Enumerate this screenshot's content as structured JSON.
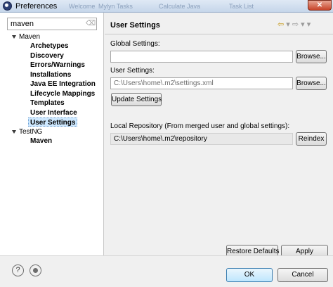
{
  "window": {
    "title": "Preferences",
    "background_tabs": [
      "Welcome",
      "Mylyn Tasks",
      "Calculate Java",
      "Task List"
    ],
    "close_label": "✕"
  },
  "filter": {
    "value": "maven",
    "clear_icon": "clear-icon"
  },
  "tree": {
    "items": [
      {
        "label": "Maven",
        "level": 0,
        "expanded": true
      },
      {
        "label": "Archetypes",
        "level": 1
      },
      {
        "label": "Discovery",
        "level": 1
      },
      {
        "label": "Errors/Warnings",
        "level": 1
      },
      {
        "label": "Installations",
        "level": 1
      },
      {
        "label": "Java EE Integration",
        "level": 1
      },
      {
        "label": "Lifecycle Mappings",
        "level": 1
      },
      {
        "label": "Templates",
        "level": 1
      },
      {
        "label": "User Interface",
        "level": 1
      },
      {
        "label": "User Settings",
        "level": 1,
        "selected": true
      },
      {
        "label": "TestNG",
        "level": 0,
        "expanded": true
      },
      {
        "label": "Maven",
        "level": 1
      }
    ]
  },
  "page": {
    "title": "User Settings",
    "global_settings_label": "Global Settings:",
    "global_settings_value": "",
    "browse_label": "Browse...",
    "user_settings_label": "User Settings:",
    "user_settings_value": "C:\\Users\\home\\.m2\\settings.xml",
    "update_settings_label": "Update Settings",
    "local_repo_label": "Local Repository (From merged user and global settings):",
    "local_repo_value": "C:\\Users\\home\\.m2\\repository",
    "reindex_label": "Reindex",
    "restore_defaults_label": "Restore Defaults",
    "apply_label": "Apply"
  },
  "bottom": {
    "help_icon": "?",
    "ok_label": "OK",
    "cancel_label": "Cancel"
  },
  "colors": {
    "selection": "#cde8ff",
    "close_button": "#c7442a",
    "default_button": "#bee6fd"
  }
}
